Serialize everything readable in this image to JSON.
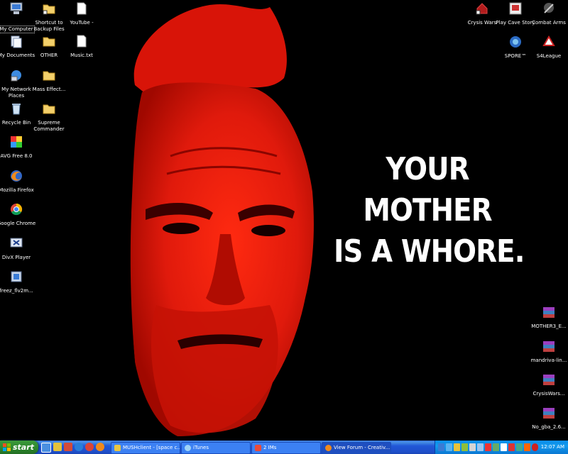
{
  "wallpaper": {
    "caption_lines": [
      "YOUR",
      "MOTHER",
      "IS A WHORE."
    ]
  },
  "desktop_icons": [
    {
      "id": "my-computer",
      "label": "My Computer",
      "icon": "computer-icon",
      "selected": true
    },
    {
      "id": "shortcut-backup",
      "label": "Shortcut to Backup Files",
      "icon": "folder-shortcut-icon"
    },
    {
      "id": "youtube",
      "label": "YouTube -",
      "icon": "text-file-icon"
    },
    {
      "id": "my-documents",
      "label": "My Documents",
      "icon": "documents-folder-icon"
    },
    {
      "id": "other",
      "label": "OTHER",
      "icon": "folder-icon"
    },
    {
      "id": "music-txt",
      "label": "Music.txt",
      "icon": "text-file-icon"
    },
    {
      "id": "my-network",
      "label": "My Network Places",
      "icon": "network-icon"
    },
    {
      "id": "mass-effect",
      "label": "Mass Effect...",
      "icon": "folder-icon"
    },
    {
      "id": "recycle-bin",
      "label": "Recycle Bin",
      "icon": "recycle-bin-icon"
    },
    {
      "id": "supreme-commander",
      "label": "Supreme Commander",
      "icon": "folder-icon"
    },
    {
      "id": "avg",
      "label": "AVG Free 8.0",
      "icon": "avg-icon"
    },
    {
      "id": "firefox",
      "label": "Mozilla Firefox",
      "icon": "firefox-icon"
    },
    {
      "id": "chrome",
      "label": "Google Chrome",
      "icon": "chrome-icon"
    },
    {
      "id": "divx",
      "label": "DivX Player",
      "icon": "divx-icon"
    },
    {
      "id": "freez",
      "label": "freez_flv2m...",
      "icon": "installer-icon"
    },
    {
      "id": "crysis-wars",
      "label": "Crysis Wars",
      "icon": "shortcut-icon"
    },
    {
      "id": "cave-story",
      "label": "Play Cave Story",
      "icon": "game-icon"
    },
    {
      "id": "combat-arms",
      "label": "Combat Arms",
      "icon": "game-icon"
    },
    {
      "id": "spore",
      "label": "SPORE™",
      "icon": "spore-icon"
    },
    {
      "id": "s4league",
      "label": "S4League",
      "icon": "game-icon"
    },
    {
      "id": "mother3",
      "label": "MOTHER3_E...",
      "icon": "archive-icon"
    },
    {
      "id": "mandriva",
      "label": "mandriva-lin...",
      "icon": "archive-icon"
    },
    {
      "id": "crysiswars-rar",
      "label": "CrysisWars...",
      "icon": "archive-icon"
    },
    {
      "id": "no-gba",
      "label": "No_gba_2.6...",
      "icon": "archive-icon"
    }
  ],
  "taskbar": {
    "start_label": "start",
    "quick_launch": [
      "show-desktop-icon",
      "aim-icon",
      "messenger-icon",
      "ie-icon",
      "chrome-icon",
      "firefox-icon"
    ],
    "tasks": [
      {
        "label": "MUSHclient - [space c...",
        "icon": "mushclient-icon"
      },
      {
        "label": "iTunes",
        "icon": "itunes-icon"
      },
      {
        "label": "2 IMs",
        "icon": "aim-icon"
      },
      {
        "label": "View Forum - Creativ...",
        "icon": "firefox-icon"
      }
    ],
    "clock": "12:07 AM"
  },
  "colors": {
    "wallpaper_red": "#e01a0c",
    "taskbar_blue": "#245edb",
    "start_green": "#2f8a2f",
    "tray_blue": "#0f8ee9"
  }
}
